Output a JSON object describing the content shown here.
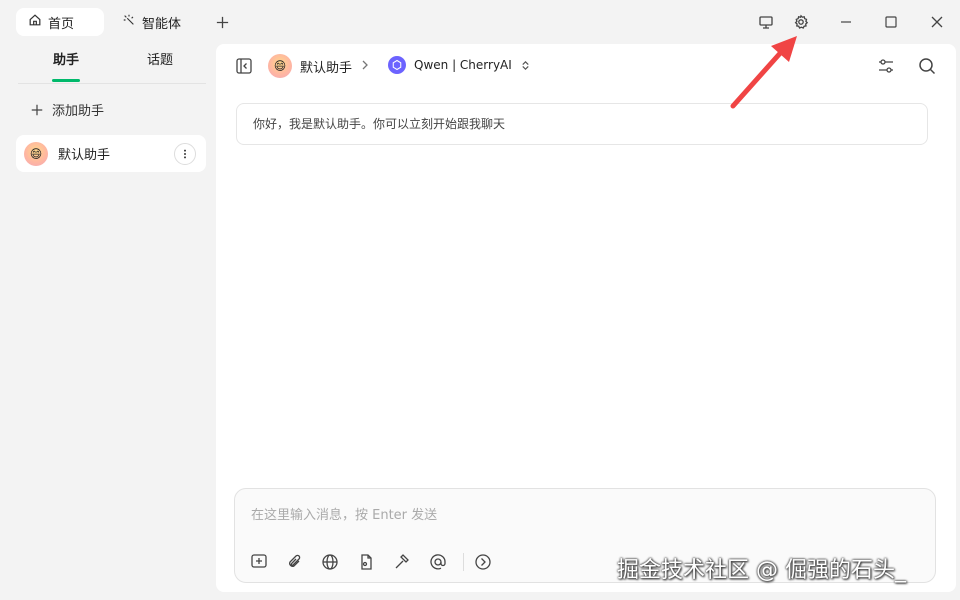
{
  "tabs": [
    {
      "label": "首页",
      "icon": "home-icon",
      "active": true
    },
    {
      "label": "智能体",
      "icon": "sparkle-icon",
      "active": false
    }
  ],
  "sidebar": {
    "tabs": [
      {
        "label": "助手",
        "active": true
      },
      {
        "label": "话题",
        "active": false
      }
    ],
    "add_label": "添加助手",
    "items": [
      {
        "label": "默认助手",
        "avatar": "smiley-avatar"
      }
    ]
  },
  "header": {
    "assistant_name": "默认助手",
    "model_name": "Qwen | CherryAI"
  },
  "chat": {
    "welcome": "你好，我是默认助手。你可以立刻开始跟我聊天"
  },
  "composer": {
    "placeholder": "在这里输入消息，按 Enter 发送"
  },
  "watermark": "掘金技术社区 @ 倔强的石头_",
  "colors": {
    "accent": "#00b96b",
    "arrow": "#f04444",
    "background": "#f3f3f3"
  }
}
